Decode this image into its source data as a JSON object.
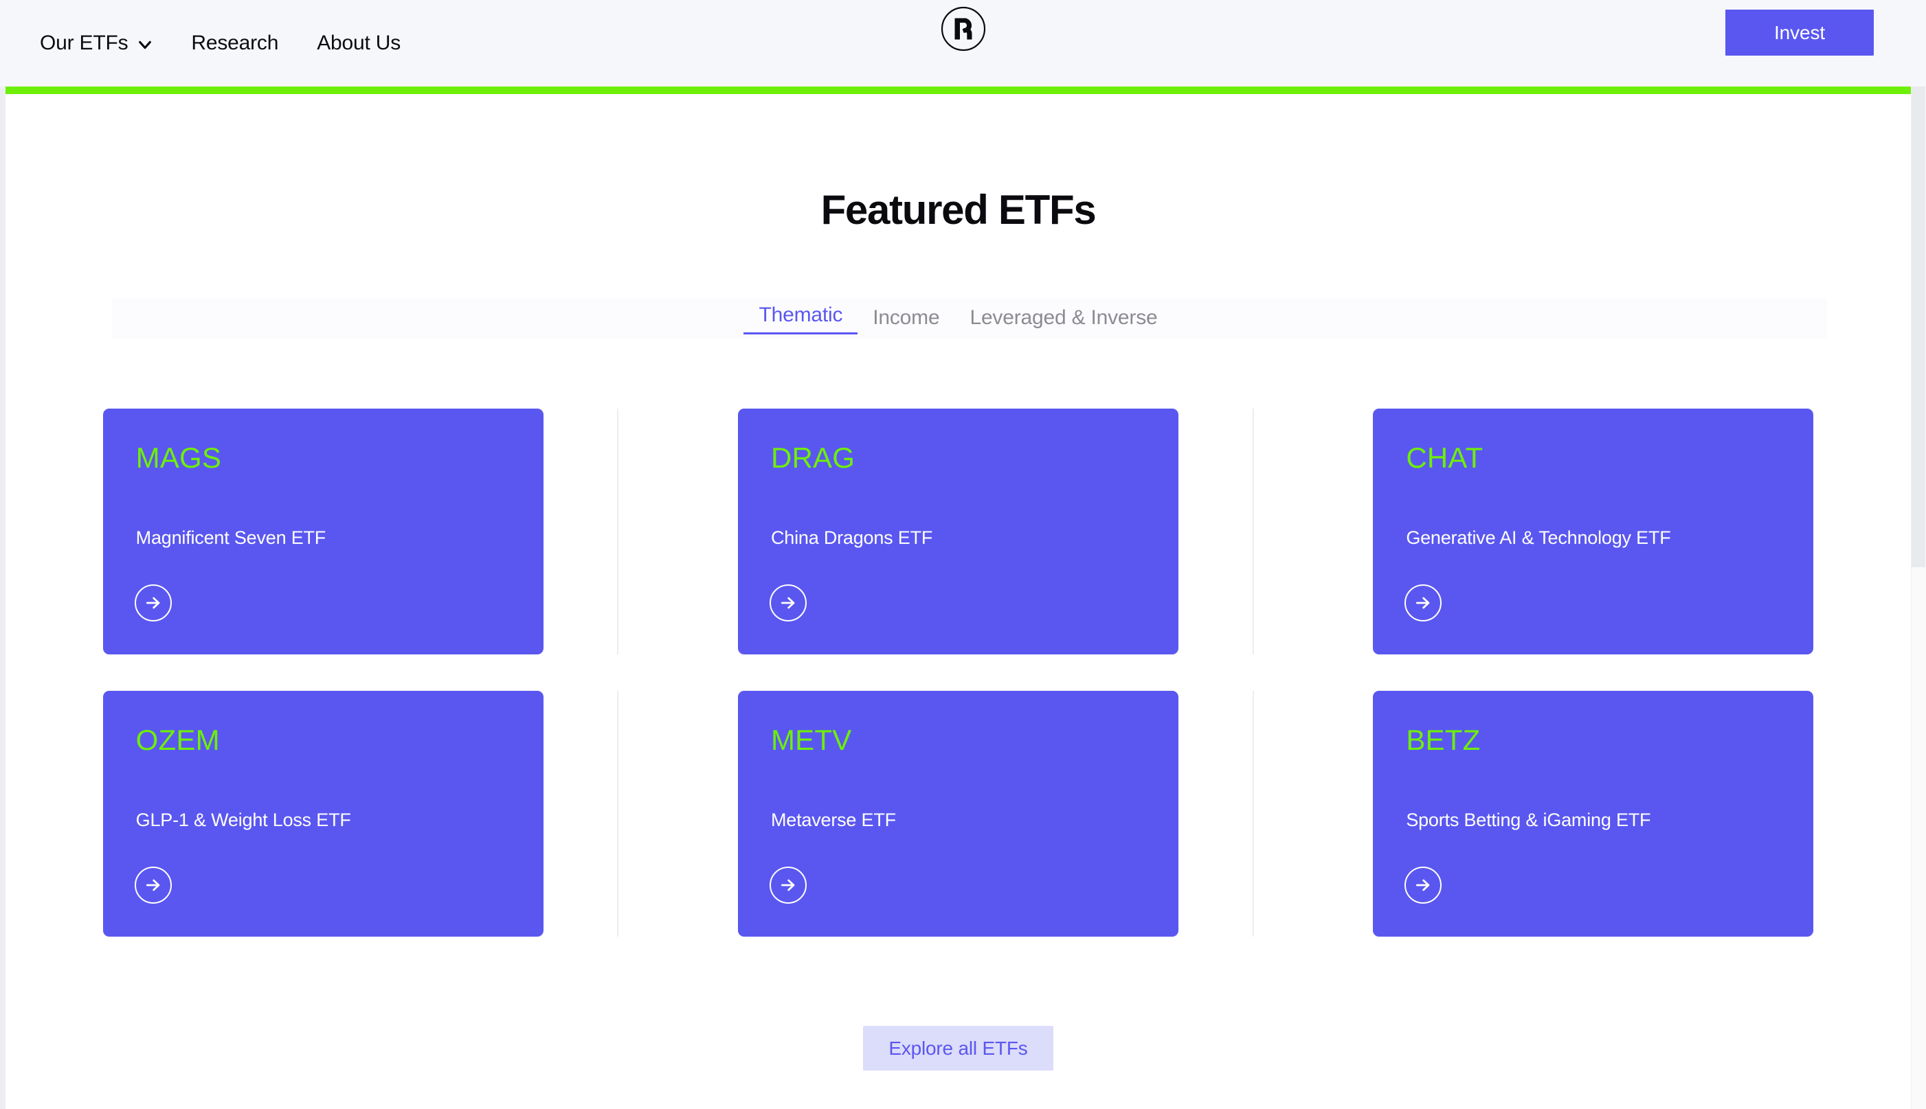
{
  "colors": {
    "brand_purple": "#5A57F0",
    "brand_green": "#6EEF09",
    "header_bg": "#F5F7FB",
    "page_bg": "#FFFFFF",
    "muted_text": "#8B8B93",
    "explore_bg": "#DCDCFB"
  },
  "header": {
    "nav": [
      {
        "label": "Our ETFs",
        "has_dropdown": true,
        "icon": "chevron-down-icon"
      },
      {
        "label": "Research",
        "has_dropdown": false
      },
      {
        "label": "About Us",
        "has_dropdown": false
      }
    ],
    "logo": {
      "icon": "roundhill-r-logo",
      "letter": "R"
    },
    "cta": {
      "label": "Invest"
    }
  },
  "main": {
    "title": "Featured ETFs",
    "tabs": [
      {
        "label": "Thematic",
        "active": true
      },
      {
        "label": "Income",
        "active": false
      },
      {
        "label": "Leveraged & Inverse",
        "active": false
      }
    ],
    "cards": [
      {
        "ticker": "MAGS",
        "name": "Magnificent Seven ETF",
        "arrow_icon": "arrow-right-icon"
      },
      {
        "ticker": "DRAG",
        "name": "China Dragons ETF",
        "arrow_icon": "arrow-right-icon"
      },
      {
        "ticker": "CHAT",
        "name": "Generative AI & Technology ETF",
        "arrow_icon": "arrow-right-icon"
      },
      {
        "ticker": "OZEM",
        "name": "GLP-1 & Weight Loss ETF",
        "arrow_icon": "arrow-right-icon"
      },
      {
        "ticker": "METV",
        "name": "Metaverse ETF",
        "arrow_icon": "arrow-right-icon"
      },
      {
        "ticker": "BETZ",
        "name": "Sports Betting & iGaming ETF",
        "arrow_icon": "arrow-right-icon"
      }
    ],
    "explore_button": {
      "label": "Explore all ETFs"
    }
  }
}
